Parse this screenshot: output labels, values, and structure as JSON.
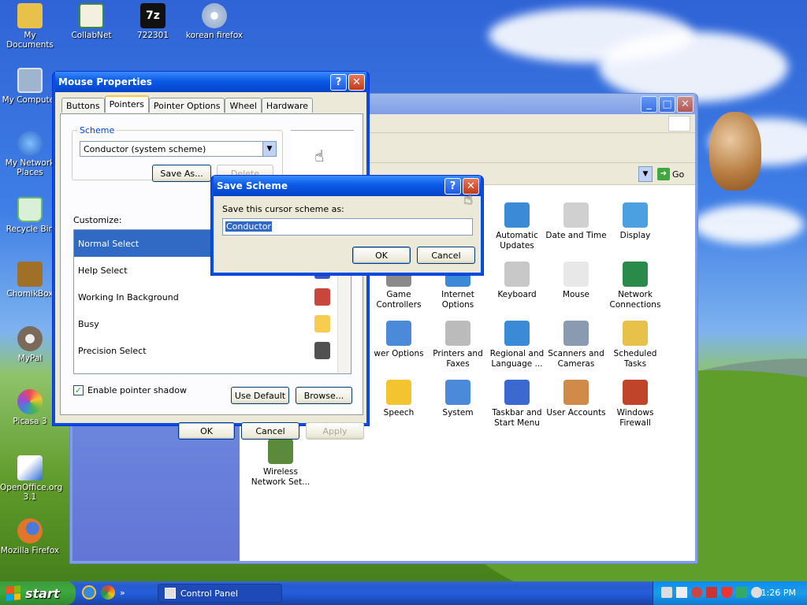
{
  "desktop": {
    "icons": [
      {
        "label": "My Documents",
        "icon": "folder-documents-icon",
        "color": "#e8c14a"
      },
      {
        "label": "CollabNet",
        "icon": "certificate-icon",
        "color": "#3c8a3c"
      },
      {
        "label": "722301",
        "icon": "7zip-icon",
        "color": "#111111"
      },
      {
        "label": "korean firefox",
        "icon": "cd-setup-icon",
        "color": "#b8c9de"
      },
      {
        "label": "My Computer",
        "icon": "computer-icon",
        "color": "#9fb4cf"
      },
      {
        "label": "My Network Places",
        "icon": "network-places-icon",
        "color": "#4a8ad8"
      },
      {
        "label": "Recycle Bin",
        "icon": "recycle-bin-icon",
        "color": "#6db86d"
      },
      {
        "label": "ChomikBox",
        "icon": "chomikbox-icon",
        "color": "#a07028"
      },
      {
        "label": "MyPal",
        "icon": "raccoon-icon",
        "color": "#7a6a5a"
      },
      {
        "label": "Picasa 3",
        "icon": "picasa-icon",
        "color": "#e84a5a"
      },
      {
        "label": "OpenOffice.org 3.1",
        "icon": "openoffice-icon",
        "color": "#2a6ad0"
      },
      {
        "label": "Mozilla Firefox",
        "icon": "firefox-icon",
        "color": "#e0762a"
      }
    ]
  },
  "control_panel": {
    "address_go": "Go",
    "items": [
      {
        "label": "Automatic Updates",
        "icon": "windows-update-icon"
      },
      {
        "label": "Date and Time",
        "icon": "clock-icon"
      },
      {
        "label": "Display",
        "icon": "display-icon"
      },
      {
        "label": "Game Controllers",
        "icon": "gamepad-icon"
      },
      {
        "label": "Internet Options",
        "icon": "globe-icon"
      },
      {
        "label": "Keyboard",
        "icon": "keyboard-icon"
      },
      {
        "label": "Mouse",
        "icon": "mouse-icon"
      },
      {
        "label": "Network Connections",
        "icon": "network-connections-icon"
      },
      {
        "label": "Power Options",
        "display_label": "wer Options",
        "icon": "power-icon"
      },
      {
        "label": "Printers and Faxes",
        "icon": "printer-icon"
      },
      {
        "label": "Regional and Language ...",
        "icon": "globe-language-icon"
      },
      {
        "label": "Scanners and Cameras",
        "icon": "scanner-icon"
      },
      {
        "label": "Scheduled Tasks",
        "icon": "scheduled-tasks-icon"
      },
      {
        "label": "Speech",
        "icon": "speech-icon"
      },
      {
        "label": "System",
        "icon": "system-icon"
      },
      {
        "label": "Taskbar and Start Menu",
        "icon": "taskbar-icon"
      },
      {
        "label": "User Accounts",
        "icon": "users-icon"
      },
      {
        "label": "Windows Firewall",
        "icon": "firewall-icon"
      },
      {
        "label": "Wireless Network Set...",
        "icon": "wireless-icon"
      }
    ]
  },
  "mouse_properties": {
    "title": "Mouse Properties",
    "tabs": [
      "Buttons",
      "Pointers",
      "Pointer Options",
      "Wheel",
      "Hardware"
    ],
    "active_tab": "Pointers",
    "scheme_label": "Scheme",
    "scheme_value": "Conductor (system scheme)",
    "save_as": "Save As...",
    "delete": "Delete",
    "customize_label": "Customize:",
    "pointers": [
      "Normal Select",
      "Help Select",
      "Working In Background",
      "Busy",
      "Precision Select"
    ],
    "selected_pointer": "Normal Select",
    "shadow_label": "Enable pointer shadow",
    "shadow_checked": true,
    "use_default": "Use Default",
    "browse": "Browse...",
    "ok": "OK",
    "cancel": "Cancel",
    "apply": "Apply"
  },
  "save_scheme": {
    "title": "Save Scheme",
    "prompt": "Save this cursor scheme as:",
    "value": "Conductor",
    "ok": "OK",
    "cancel": "Cancel"
  },
  "taskbar": {
    "start": "start",
    "task": "Control Panel",
    "clock": "1:26 PM"
  },
  "colors": {
    "xp_blue": "#0a4ee0",
    "selection": "#316ac5",
    "dialog_face": "#ece9d8",
    "start_green": "#3c9a3c"
  }
}
